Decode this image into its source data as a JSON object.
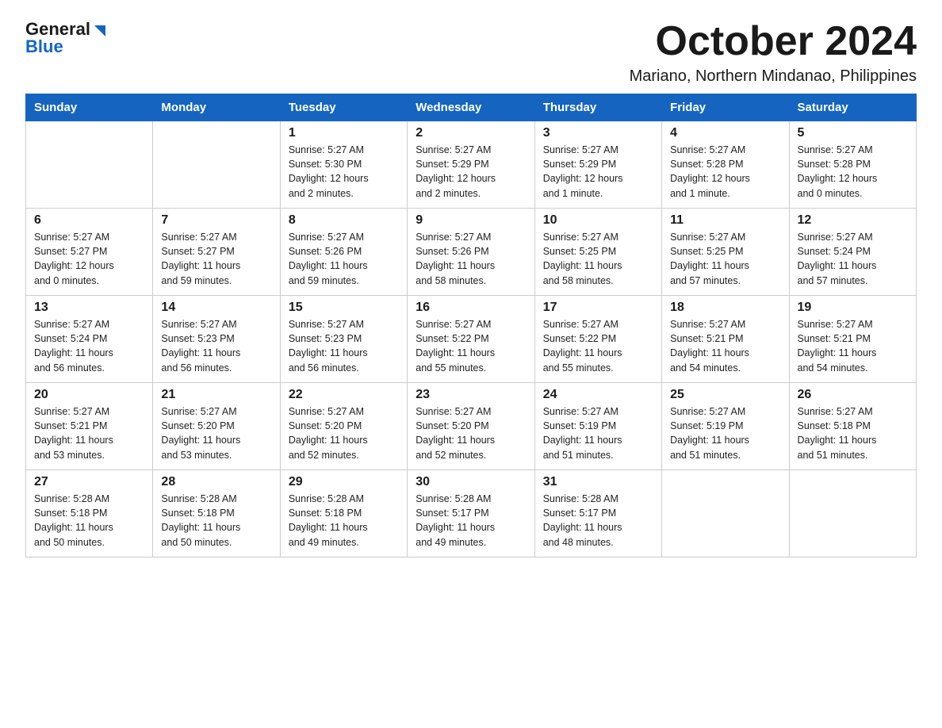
{
  "logo": {
    "text_general": "General",
    "text_blue": "Blue"
  },
  "title": "October 2024",
  "subtitle": "Mariano, Northern Mindanao, Philippines",
  "days_of_week": [
    "Sunday",
    "Monday",
    "Tuesday",
    "Wednesday",
    "Thursday",
    "Friday",
    "Saturday"
  ],
  "weeks": [
    [
      {
        "day": "",
        "info": ""
      },
      {
        "day": "",
        "info": ""
      },
      {
        "day": "1",
        "info": "Sunrise: 5:27 AM\nSunset: 5:30 PM\nDaylight: 12 hours\nand 2 minutes."
      },
      {
        "day": "2",
        "info": "Sunrise: 5:27 AM\nSunset: 5:29 PM\nDaylight: 12 hours\nand 2 minutes."
      },
      {
        "day": "3",
        "info": "Sunrise: 5:27 AM\nSunset: 5:29 PM\nDaylight: 12 hours\nand 1 minute."
      },
      {
        "day": "4",
        "info": "Sunrise: 5:27 AM\nSunset: 5:28 PM\nDaylight: 12 hours\nand 1 minute."
      },
      {
        "day": "5",
        "info": "Sunrise: 5:27 AM\nSunset: 5:28 PM\nDaylight: 12 hours\nand 0 minutes."
      }
    ],
    [
      {
        "day": "6",
        "info": "Sunrise: 5:27 AM\nSunset: 5:27 PM\nDaylight: 12 hours\nand 0 minutes."
      },
      {
        "day": "7",
        "info": "Sunrise: 5:27 AM\nSunset: 5:27 PM\nDaylight: 11 hours\nand 59 minutes."
      },
      {
        "day": "8",
        "info": "Sunrise: 5:27 AM\nSunset: 5:26 PM\nDaylight: 11 hours\nand 59 minutes."
      },
      {
        "day": "9",
        "info": "Sunrise: 5:27 AM\nSunset: 5:26 PM\nDaylight: 11 hours\nand 58 minutes."
      },
      {
        "day": "10",
        "info": "Sunrise: 5:27 AM\nSunset: 5:25 PM\nDaylight: 11 hours\nand 58 minutes."
      },
      {
        "day": "11",
        "info": "Sunrise: 5:27 AM\nSunset: 5:25 PM\nDaylight: 11 hours\nand 57 minutes."
      },
      {
        "day": "12",
        "info": "Sunrise: 5:27 AM\nSunset: 5:24 PM\nDaylight: 11 hours\nand 57 minutes."
      }
    ],
    [
      {
        "day": "13",
        "info": "Sunrise: 5:27 AM\nSunset: 5:24 PM\nDaylight: 11 hours\nand 56 minutes."
      },
      {
        "day": "14",
        "info": "Sunrise: 5:27 AM\nSunset: 5:23 PM\nDaylight: 11 hours\nand 56 minutes."
      },
      {
        "day": "15",
        "info": "Sunrise: 5:27 AM\nSunset: 5:23 PM\nDaylight: 11 hours\nand 56 minutes."
      },
      {
        "day": "16",
        "info": "Sunrise: 5:27 AM\nSunset: 5:22 PM\nDaylight: 11 hours\nand 55 minutes."
      },
      {
        "day": "17",
        "info": "Sunrise: 5:27 AM\nSunset: 5:22 PM\nDaylight: 11 hours\nand 55 minutes."
      },
      {
        "day": "18",
        "info": "Sunrise: 5:27 AM\nSunset: 5:21 PM\nDaylight: 11 hours\nand 54 minutes."
      },
      {
        "day": "19",
        "info": "Sunrise: 5:27 AM\nSunset: 5:21 PM\nDaylight: 11 hours\nand 54 minutes."
      }
    ],
    [
      {
        "day": "20",
        "info": "Sunrise: 5:27 AM\nSunset: 5:21 PM\nDaylight: 11 hours\nand 53 minutes."
      },
      {
        "day": "21",
        "info": "Sunrise: 5:27 AM\nSunset: 5:20 PM\nDaylight: 11 hours\nand 53 minutes."
      },
      {
        "day": "22",
        "info": "Sunrise: 5:27 AM\nSunset: 5:20 PM\nDaylight: 11 hours\nand 52 minutes."
      },
      {
        "day": "23",
        "info": "Sunrise: 5:27 AM\nSunset: 5:20 PM\nDaylight: 11 hours\nand 52 minutes."
      },
      {
        "day": "24",
        "info": "Sunrise: 5:27 AM\nSunset: 5:19 PM\nDaylight: 11 hours\nand 51 minutes."
      },
      {
        "day": "25",
        "info": "Sunrise: 5:27 AM\nSunset: 5:19 PM\nDaylight: 11 hours\nand 51 minutes."
      },
      {
        "day": "26",
        "info": "Sunrise: 5:27 AM\nSunset: 5:18 PM\nDaylight: 11 hours\nand 51 minutes."
      }
    ],
    [
      {
        "day": "27",
        "info": "Sunrise: 5:28 AM\nSunset: 5:18 PM\nDaylight: 11 hours\nand 50 minutes."
      },
      {
        "day": "28",
        "info": "Sunrise: 5:28 AM\nSunset: 5:18 PM\nDaylight: 11 hours\nand 50 minutes."
      },
      {
        "day": "29",
        "info": "Sunrise: 5:28 AM\nSunset: 5:18 PM\nDaylight: 11 hours\nand 49 minutes."
      },
      {
        "day": "30",
        "info": "Sunrise: 5:28 AM\nSunset: 5:17 PM\nDaylight: 11 hours\nand 49 minutes."
      },
      {
        "day": "31",
        "info": "Sunrise: 5:28 AM\nSunset: 5:17 PM\nDaylight: 11 hours\nand 48 minutes."
      },
      {
        "day": "",
        "info": ""
      },
      {
        "day": "",
        "info": ""
      }
    ]
  ]
}
